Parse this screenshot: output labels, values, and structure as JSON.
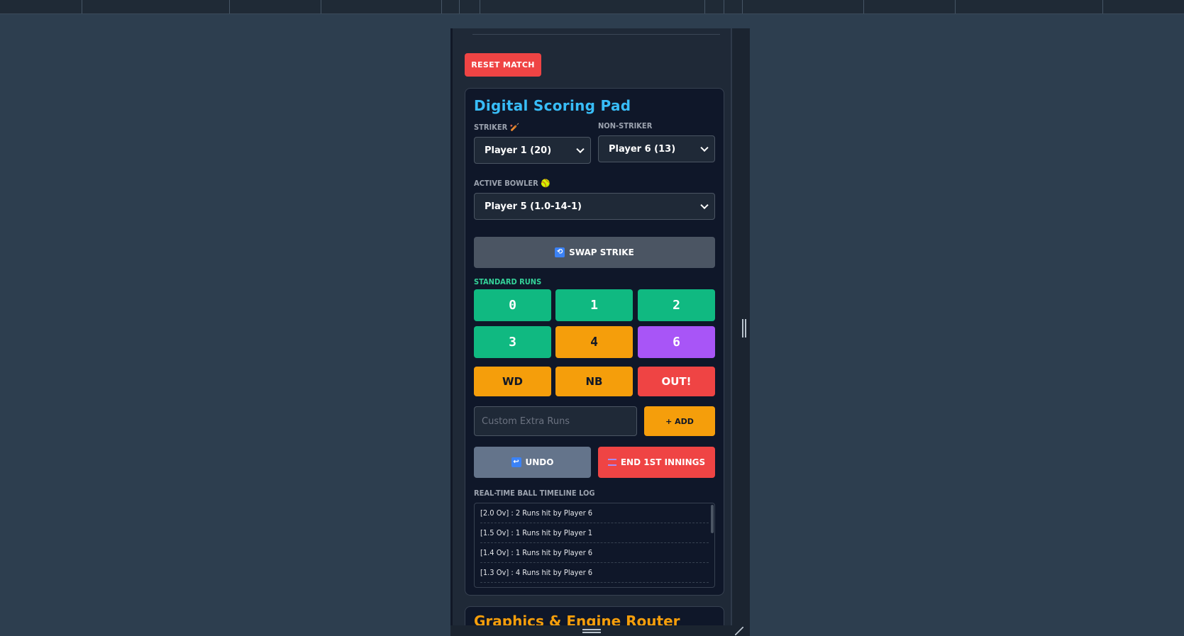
{
  "header": {
    "reset_label": "RESET MATCH"
  },
  "scoring": {
    "title": "Digital Scoring Pad",
    "striker_label": "STRIKER 🏏",
    "nonstriker_label": "NON-STRIKER",
    "striker_value": "Player 1 (20)",
    "nonstriker_value": "Player 6 (13)",
    "bowler_label": "ACTIVE BOWLER 🥎",
    "bowler_value": "Player 5 (1.0-14-1)",
    "swap_icon": "🔄",
    "swap_label": "SWAP STRIKE",
    "runs_label": "STANDARD RUNS",
    "runs": [
      "0",
      "1",
      "2",
      "3",
      "4",
      "6"
    ],
    "extras": [
      "WD",
      "NB",
      "OUT!"
    ],
    "custom_placeholder": "Custom Extra Runs",
    "add_label": "+ ADD",
    "undo_icon": "↩",
    "undo_label": "UNDO",
    "end_label": "END 1ST INNINGS",
    "log_label": "REAL-TIME BALL TIMELINE LOG",
    "log": [
      "[2.0 Ov] : 2 Runs hit by Player 6",
      "[1.5 Ov] : 1 Runs hit by Player 1",
      "[1.4 Ov] : 1 Runs hit by Player 6",
      "[1.3 Ov] : 4 Runs hit by Player 6"
    ]
  },
  "graphics": {
    "title": "Graphics & Engine Router"
  },
  "colors": {
    "green": "#10b981",
    "orange": "#f59e0b",
    "purple": "#a855f7",
    "red": "#ef4444",
    "title_blue": "#38bdf8"
  }
}
